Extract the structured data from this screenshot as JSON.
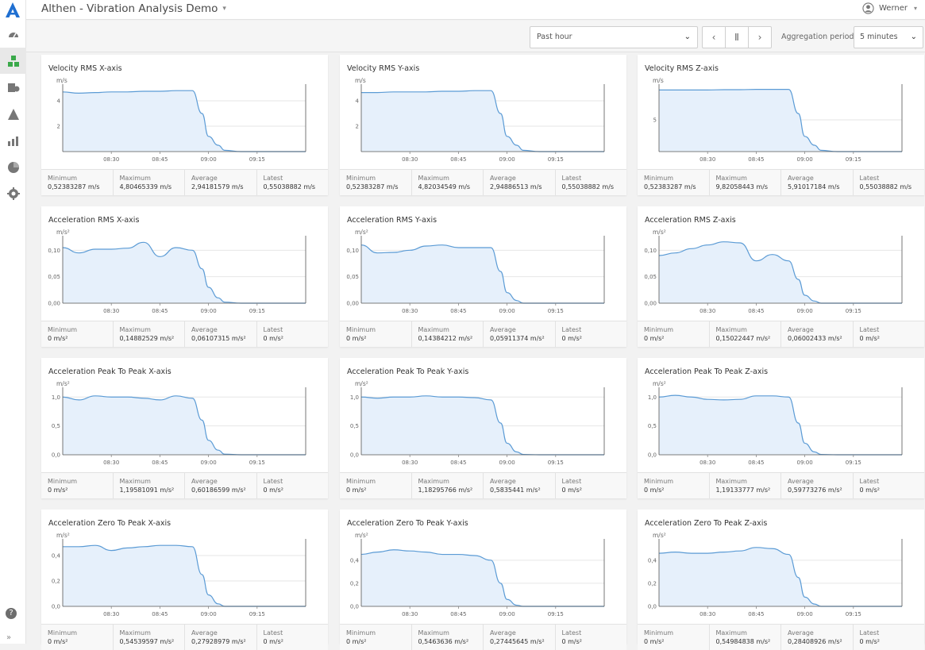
{
  "app": {
    "title": "Althen - Vibration Analysis Demo",
    "user": "Werner"
  },
  "colors": {
    "accent": "#1f6fd1",
    "line": "#5b9bd5",
    "fill": "#e6f0fb",
    "sidebar_active": "#3aa94a"
  },
  "sidebar": {
    "items": [
      {
        "icon": "dashboard-gauge-icon"
      },
      {
        "icon": "widgets-icon",
        "active": true
      },
      {
        "icon": "devices-icon"
      },
      {
        "icon": "alarm-warning-icon"
      },
      {
        "icon": "analytics-chart-icon"
      },
      {
        "icon": "reports-pie-icon"
      },
      {
        "icon": "settings-gear-icon"
      }
    ],
    "help_label": "?",
    "expand_label": "»"
  },
  "toolbar": {
    "time_range": "Past hour",
    "prev_label": "‹",
    "pause_label": "Ⅱ",
    "next_label": "›",
    "aggregation_label": "Aggregation period:",
    "aggregation_value": "5 minutes"
  },
  "stat_labels": {
    "min": "Minimum",
    "max": "Maximum",
    "avg": "Average",
    "latest": "Latest"
  },
  "charts": [
    {
      "title": "Velocity RMS X-axis",
      "unit": "m/s",
      "ylim": [
        0,
        5
      ],
      "yticks": [
        "2",
        "4"
      ],
      "xticks": [
        "08:30",
        "08:45",
        "09:00",
        "09:15"
      ],
      "stats": {
        "min": "0,52383287 m/s",
        "max": "4,80465339 m/s",
        "avg": "2,94181579 m/s",
        "latest": "0,55038882 m/s"
      },
      "chart_data": {
        "type": "area",
        "x": [
          "08:15",
          "08:20",
          "08:25",
          "08:30",
          "08:35",
          "08:40",
          "08:45",
          "08:50",
          "08:55",
          "08:58",
          "09:00",
          "09:03",
          "09:05",
          "09:10",
          "09:15",
          "09:20",
          "09:25",
          "09:30"
        ],
        "y": [
          4.7,
          4.6,
          4.65,
          4.7,
          4.7,
          4.75,
          4.75,
          4.8,
          4.8,
          3.0,
          1.2,
          0.5,
          0.1,
          0,
          0,
          0,
          0,
          0
        ]
      }
    },
    {
      "title": "Velocity RMS Y-axis",
      "unit": "m/s",
      "ylim": [
        0,
        5
      ],
      "yticks": [
        "2",
        "4"
      ],
      "xticks": [
        "08:30",
        "08:45",
        "09:00",
        "09:15"
      ],
      "stats": {
        "min": "0,52383287 m/s",
        "max": "4,82034549 m/s",
        "avg": "2,94886513 m/s",
        "latest": "0,55038882 m/s"
      },
      "chart_data": {
        "type": "area",
        "x": [
          "08:15",
          "08:20",
          "08:25",
          "08:30",
          "08:35",
          "08:40",
          "08:45",
          "08:50",
          "08:55",
          "08:58",
          "09:00",
          "09:03",
          "09:05",
          "09:10",
          "09:15",
          "09:20",
          "09:25",
          "09:30"
        ],
        "y": [
          4.65,
          4.65,
          4.7,
          4.7,
          4.7,
          4.75,
          4.75,
          4.8,
          4.8,
          3.0,
          1.2,
          0.5,
          0.1,
          0,
          0,
          0,
          0,
          0
        ]
      }
    },
    {
      "title": "Velocity RMS Z-axis",
      "unit": "m/s",
      "ylim": [
        0,
        10
      ],
      "yticks": [
        "5"
      ],
      "xticks": [
        "08:30",
        "08:45",
        "09:00",
        "09:15"
      ],
      "stats": {
        "min": "0,52383287 m/s",
        "max": "9,82058443 m/s",
        "avg": "5,91017184 m/s",
        "latest": "0,55038882 m/s"
      },
      "chart_data": {
        "type": "area",
        "x": [
          "08:15",
          "08:20",
          "08:25",
          "08:30",
          "08:35",
          "08:40",
          "08:45",
          "08:50",
          "08:55",
          "08:58",
          "09:00",
          "09:03",
          "09:05",
          "09:10",
          "09:15",
          "09:20",
          "09:25",
          "09:30"
        ],
        "y": [
          9.7,
          9.7,
          9.7,
          9.7,
          9.75,
          9.75,
          9.8,
          9.8,
          9.8,
          6.0,
          2.4,
          1.0,
          0.2,
          0,
          0,
          0,
          0,
          0
        ]
      }
    },
    {
      "title": "Acceleration RMS X-axis",
      "unit": "m/s²",
      "ylim": [
        0,
        0.12
      ],
      "yticks": [
        "0,00",
        "0,05",
        "0,10"
      ],
      "xticks": [
        "08:30",
        "08:45",
        "09:00",
        "09:15"
      ],
      "stats": {
        "min": "0 m/s²",
        "max": "0,14882529 m/s²",
        "avg": "0,06107315 m/s²",
        "latest": "0 m/s²"
      },
      "chart_data": {
        "type": "area",
        "x": [
          "08:15",
          "08:20",
          "08:25",
          "08:30",
          "08:35",
          "08:40",
          "08:45",
          "08:50",
          "08:55",
          "08:58",
          "09:00",
          "09:03",
          "09:05",
          "09:10",
          "09:15",
          "09:20",
          "09:25",
          "09:30"
        ],
        "y": [
          0.105,
          0.095,
          0.102,
          0.102,
          0.104,
          0.115,
          0.088,
          0.105,
          0.1,
          0.065,
          0.03,
          0.01,
          0.002,
          0,
          0,
          0,
          0,
          0
        ]
      }
    },
    {
      "title": "Acceleration RMS Y-axis",
      "unit": "m/s²",
      "ylim": [
        0,
        0.12
      ],
      "yticks": [
        "0,00",
        "0,05",
        "0,10"
      ],
      "xticks": [
        "08:30",
        "08:45",
        "09:00",
        "09:15"
      ],
      "stats": {
        "min": "0 m/s²",
        "max": "0,14384212 m/s²",
        "avg": "0,05911374 m/s²",
        "latest": "0 m/s²"
      },
      "chart_data": {
        "type": "area",
        "x": [
          "08:15",
          "08:20",
          "08:25",
          "08:30",
          "08:35",
          "08:40",
          "08:45",
          "08:50",
          "08:55",
          "08:58",
          "09:00",
          "09:03",
          "09:05",
          "09:10",
          "09:15",
          "09:20",
          "09:25",
          "09:30"
        ],
        "y": [
          0.11,
          0.095,
          0.096,
          0.1,
          0.108,
          0.11,
          0.105,
          0.105,
          0.105,
          0.06,
          0.02,
          0.005,
          0,
          0,
          0,
          0,
          0,
          0
        ]
      }
    },
    {
      "title": "Acceleration RMS Z-axis",
      "unit": "m/s²",
      "ylim": [
        0,
        0.12
      ],
      "yticks": [
        "0,00",
        "0,05",
        "0,10"
      ],
      "xticks": [
        "08:30",
        "08:45",
        "09:00",
        "09:15"
      ],
      "stats": {
        "min": "0 m/s²",
        "max": "0,15022447 m/s²",
        "avg": "0,06002433 m/s²",
        "latest": "0 m/s²"
      },
      "chart_data": {
        "type": "area",
        "x": [
          "08:15",
          "08:20",
          "08:25",
          "08:30",
          "08:35",
          "08:40",
          "08:45",
          "08:50",
          "08:55",
          "08:58",
          "09:00",
          "09:03",
          "09:05",
          "09:10",
          "09:15",
          "09:20",
          "09:25",
          "09:30"
        ],
        "y": [
          0.09,
          0.095,
          0.103,
          0.11,
          0.116,
          0.114,
          0.08,
          0.092,
          0.08,
          0.045,
          0.015,
          0.004,
          0,
          0,
          0,
          0,
          0,
          0
        ]
      }
    },
    {
      "title": "Acceleration Peak To Peak X-axis",
      "unit": "m/s²",
      "ylim": [
        0,
        1.1
      ],
      "yticks": [
        "0,0",
        "0,5",
        "1,0"
      ],
      "xticks": [
        "08:30",
        "08:45",
        "09:00",
        "09:15"
      ],
      "stats": {
        "min": "0 m/s²",
        "max": "1,19581091 m/s²",
        "avg": "0,60186599 m/s²",
        "latest": "0 m/s²"
      },
      "chart_data": {
        "type": "area",
        "x": [
          "08:15",
          "08:20",
          "08:25",
          "08:30",
          "08:35",
          "08:40",
          "08:45",
          "08:50",
          "08:55",
          "08:58",
          "09:00",
          "09:03",
          "09:05",
          "09:10",
          "09:15",
          "09:20",
          "09:25",
          "09:30"
        ],
        "y": [
          1.0,
          0.95,
          1.02,
          1.0,
          1.0,
          0.98,
          0.95,
          1.02,
          0.98,
          0.6,
          0.25,
          0.08,
          0.01,
          0,
          0,
          0,
          0,
          0
        ]
      }
    },
    {
      "title": "Acceleration Peak To Peak Y-axis",
      "unit": "m/s²",
      "ylim": [
        0,
        1.1
      ],
      "yticks": [
        "0,0",
        "0,5",
        "1,0"
      ],
      "xticks": [
        "08:30",
        "08:45",
        "09:00",
        "09:15"
      ],
      "stats": {
        "min": "0 m/s²",
        "max": "1,18295766 m/s²",
        "avg": "0,5835441 m/s²",
        "latest": "0 m/s²"
      },
      "chart_data": {
        "type": "area",
        "x": [
          "08:15",
          "08:20",
          "08:25",
          "08:30",
          "08:35",
          "08:40",
          "08:45",
          "08:50",
          "08:55",
          "08:58",
          "09:00",
          "09:03",
          "09:05",
          "09:10",
          "09:15",
          "09:20",
          "09:25",
          "09:30"
        ],
        "y": [
          1.0,
          0.98,
          1.0,
          1.0,
          1.02,
          1.0,
          1.0,
          0.99,
          0.95,
          0.55,
          0.2,
          0.05,
          0.005,
          0,
          0,
          0,
          0,
          0
        ]
      }
    },
    {
      "title": "Acceleration Peak To Peak Z-axis",
      "unit": "m/s²",
      "ylim": [
        0,
        1.1
      ],
      "yticks": [
        "0,0",
        "0,5",
        "1,0"
      ],
      "xticks": [
        "08:30",
        "08:45",
        "09:00",
        "09:15"
      ],
      "stats": {
        "min": "0 m/s²",
        "max": "1,19133777 m/s²",
        "avg": "0,59773276 m/s²",
        "latest": "0 m/s²"
      },
      "chart_data": {
        "type": "area",
        "x": [
          "08:15",
          "08:20",
          "08:25",
          "08:30",
          "08:35",
          "08:40",
          "08:45",
          "08:50",
          "08:55",
          "08:58",
          "09:00",
          "09:03",
          "09:05",
          "09:10",
          "09:15",
          "09:20",
          "09:25",
          "09:30"
        ],
        "y": [
          1.0,
          1.03,
          1.0,
          0.96,
          0.95,
          0.96,
          1.02,
          1.02,
          1.0,
          0.55,
          0.2,
          0.05,
          0.005,
          0,
          0,
          0,
          0,
          0
        ]
      }
    },
    {
      "title": "Acceleration Zero To Peak X-axis",
      "unit": "m/s²",
      "ylim": [
        0,
        0.5
      ],
      "yticks": [
        "0,0",
        "0,2",
        "0,4"
      ],
      "xticks": [
        "08:30",
        "08:45",
        "09:00",
        "09:15"
      ],
      "stats": {
        "min": "0 m/s²",
        "max": "0,54539597 m/s²",
        "avg": "0,27928979 m/s²",
        "latest": "0 m/s²"
      },
      "chart_data": {
        "type": "area",
        "x": [
          "08:15",
          "08:20",
          "08:25",
          "08:30",
          "08:35",
          "08:40",
          "08:45",
          "08:50",
          "08:55",
          "08:58",
          "09:00",
          "09:03",
          "09:05",
          "09:10",
          "09:15",
          "09:20",
          "09:25",
          "09:30"
        ],
        "y": [
          0.47,
          0.47,
          0.48,
          0.44,
          0.46,
          0.47,
          0.48,
          0.48,
          0.47,
          0.25,
          0.09,
          0.02,
          0,
          0,
          0,
          0,
          0,
          0
        ]
      }
    },
    {
      "title": "Acceleration Zero To Peak Y-axis",
      "unit": "m/s²",
      "ylim": [
        0,
        0.55
      ],
      "yticks": [
        "0,0",
        "0,2",
        "0,4"
      ],
      "xticks": [
        "08:30",
        "08:45",
        "09:00",
        "09:15"
      ],
      "stats": {
        "min": "0 m/s²",
        "max": "0,5463636 m/s²",
        "avg": "0,27445645 m/s²",
        "latest": "0 m/s²"
      },
      "chart_data": {
        "type": "area",
        "x": [
          "08:15",
          "08:20",
          "08:25",
          "08:30",
          "08:35",
          "08:40",
          "08:45",
          "08:50",
          "08:55",
          "08:58",
          "09:00",
          "09:03",
          "09:05",
          "09:10",
          "09:15",
          "09:20",
          "09:25",
          "09:30"
        ],
        "y": [
          0.45,
          0.47,
          0.49,
          0.48,
          0.47,
          0.45,
          0.45,
          0.44,
          0.4,
          0.2,
          0.06,
          0.01,
          0,
          0,
          0,
          0,
          0,
          0
        ]
      }
    },
    {
      "title": "Acceleration Zero To Peak Z-axis",
      "unit": "m/s²",
      "ylim": [
        0,
        0.55
      ],
      "yticks": [
        "0,0",
        "0,2",
        "0,4"
      ],
      "xticks": [
        "08:30",
        "08:45",
        "09:00",
        "09:15"
      ],
      "stats": {
        "min": "0 m/s²",
        "max": "0,54984838 m/s²",
        "avg": "0,28408926 m/s²",
        "latest": "0 m/s²"
      },
      "chart_data": {
        "type": "area",
        "x": [
          "08:15",
          "08:20",
          "08:25",
          "08:30",
          "08:35",
          "08:40",
          "08:45",
          "08:50",
          "08:55",
          "08:58",
          "09:00",
          "09:03",
          "09:05",
          "09:10",
          "09:15",
          "09:20",
          "09:25",
          "09:30"
        ],
        "y": [
          0.46,
          0.47,
          0.46,
          0.46,
          0.47,
          0.48,
          0.51,
          0.5,
          0.45,
          0.25,
          0.08,
          0.02,
          0,
          0,
          0,
          0,
          0,
          0
        ]
      }
    }
  ]
}
